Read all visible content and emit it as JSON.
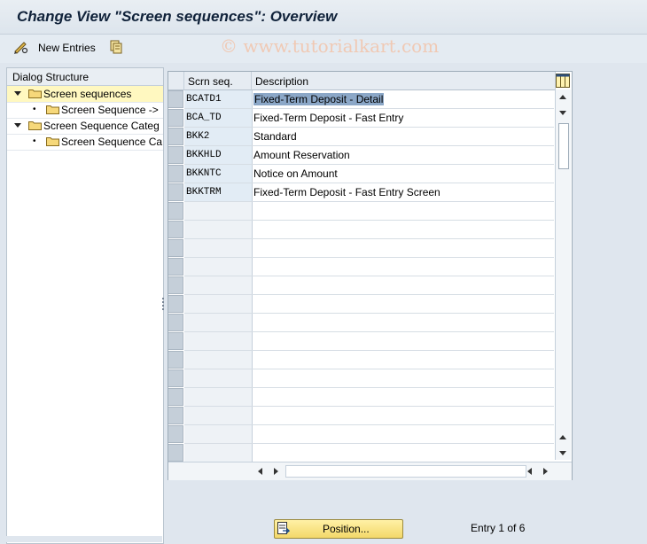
{
  "title": "Change View \"Screen sequences\": Overview",
  "watermark": "© www.tutorialkart.com",
  "toolbar": {
    "new_entries_label": "New Entries",
    "icons": [
      "pencil-glasses-icon",
      "copy-entries-icon"
    ]
  },
  "dialog_structure": {
    "header": "Dialog Structure",
    "items": [
      {
        "label": "Screen sequences",
        "level": 0,
        "expanded": true,
        "selected": true
      },
      {
        "label": "Screen Sequence ->",
        "level": 1
      },
      {
        "label": "Screen Sequence Categ",
        "level": 0,
        "expanded": true
      },
      {
        "label": "Screen Sequence Ca",
        "level": 1
      }
    ]
  },
  "table": {
    "columns": [
      "Scrn seq.",
      "Description"
    ],
    "rows": [
      {
        "seq": "BCATD1",
        "desc": "Fixed-Term Deposit - Detail"
      },
      {
        "seq": "BCA_TD",
        "desc": "Fixed-Term Deposit - Fast Entry"
      },
      {
        "seq": "BKK2",
        "desc": "Standard"
      },
      {
        "seq": "BKKHLD",
        "desc": "Amount Reservation"
      },
      {
        "seq": "BKKNTC",
        "desc": "Notice on Amount"
      },
      {
        "seq": "BKKTRM",
        "desc": "Fixed-Term Deposit - Fast Entry Screen"
      }
    ],
    "empty_rows": 14
  },
  "position_button": "Position...",
  "entry_info": "Entry 1 of 6",
  "colors": {
    "selection_highlight": "#8ba7c7",
    "tree_selected": "#fff8c0",
    "button_yellow": "#f3d869"
  }
}
